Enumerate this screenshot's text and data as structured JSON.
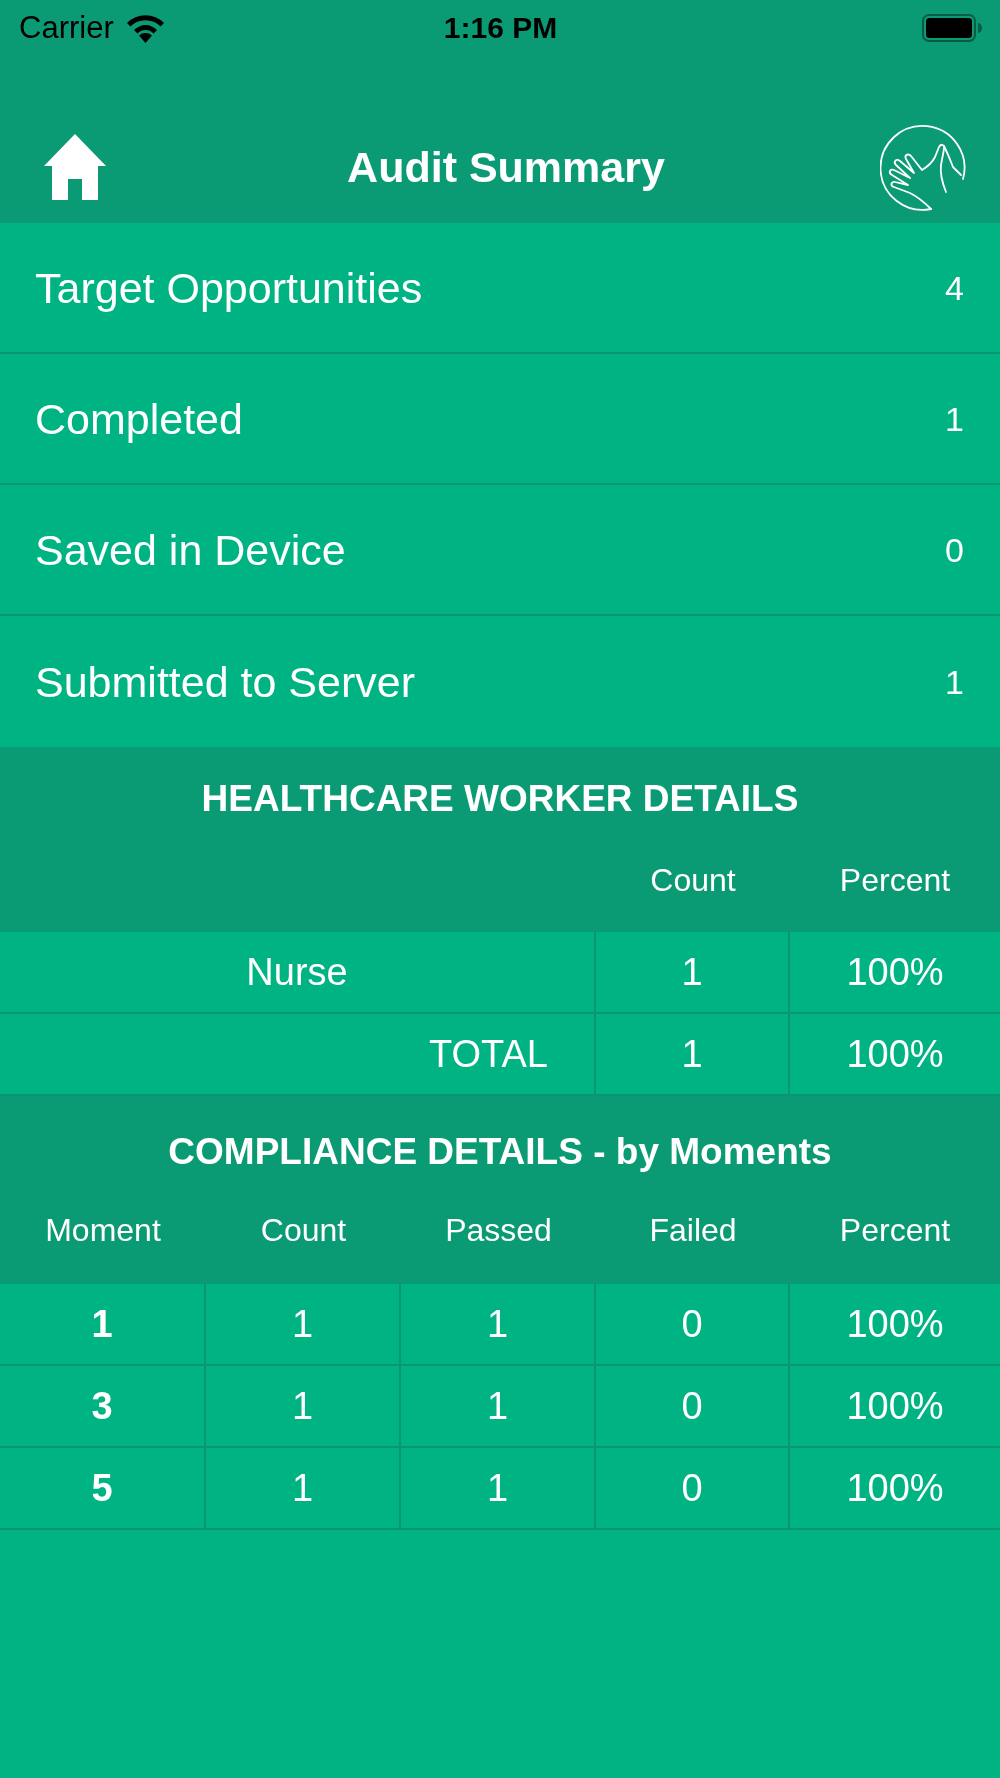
{
  "status_bar": {
    "carrier": "Carrier",
    "time": "1:16 PM"
  },
  "nav_bar": {
    "title": "Audit Summary"
  },
  "summary": [
    {
      "label": "Target Opportunities",
      "value": "4"
    },
    {
      "label": "Completed",
      "value": "1"
    },
    {
      "label": "Saved in Device",
      "value": "0"
    },
    {
      "label": "Submitted to Server",
      "value": "1"
    }
  ],
  "healthcare_worker_details": {
    "title": "HEALTHCARE WORKER DETAILS",
    "columns": [
      "",
      "Count",
      "Percent"
    ],
    "rows": [
      {
        "kind": "role",
        "cells": [
          "Nurse",
          "1",
          "100%"
        ]
      },
      {
        "kind": "total",
        "cells": [
          "TOTAL",
          "1",
          "100%"
        ]
      }
    ]
  },
  "compliance_details": {
    "title": "COMPLIANCE DETAILS - by Moments",
    "columns": [
      "Moment",
      "Count",
      "Passed",
      "Failed",
      "Percent"
    ],
    "rows": [
      [
        "1",
        "1",
        "1",
        "0",
        "100%"
      ],
      [
        "3",
        "1",
        "1",
        "0",
        "100%"
      ],
      [
        "5",
        "1",
        "1",
        "0",
        "100%"
      ]
    ]
  }
}
